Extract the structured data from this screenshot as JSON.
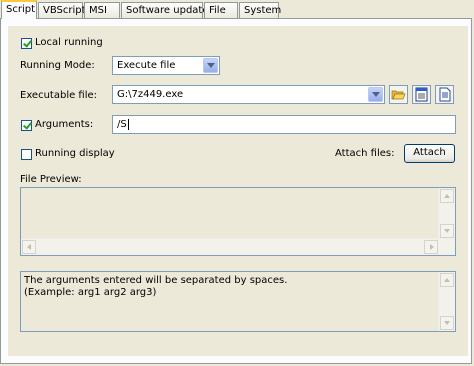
{
  "tabs": [
    "Script",
    "VBScript",
    "MSI",
    "Software update",
    "File",
    "System"
  ],
  "local_running": {
    "label": "Local running",
    "checked": true
  },
  "running_mode": {
    "label": "Running Mode:",
    "value": "Execute file"
  },
  "executable": {
    "label": "Executable file:",
    "value": "G:\\7z449.exe"
  },
  "arguments": {
    "label": "Arguments:",
    "checked": true,
    "value": "/S"
  },
  "running_display": {
    "label": "Running display",
    "checked": false
  },
  "attach": {
    "label": "Attach files:",
    "button": "Attach"
  },
  "file_preview": {
    "label": "File Preview:"
  },
  "help_text": {
    "line1": "The arguments entered will be separated by spaces.",
    "line2": "(Example: arg1 arg2 arg3)"
  },
  "colors": {
    "accent": "#ffc83c",
    "border": "#7f9db9",
    "background": "#ece9d8"
  },
  "icons": [
    "folder-open-icon",
    "list-window-icon",
    "document-icon"
  ]
}
